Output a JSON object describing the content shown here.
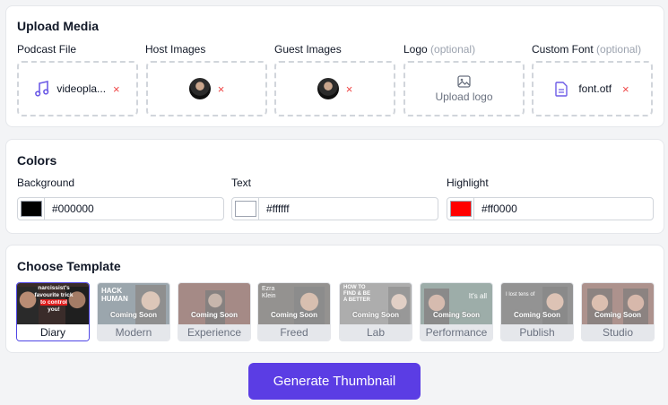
{
  "upload": {
    "title": "Upload Media",
    "podcast_label": "Podcast File",
    "podcast_file": "videopla...",
    "host_label": "Host Images",
    "guest_label": "Guest Images",
    "logo_label": "Logo",
    "logo_optional": "(optional)",
    "logo_placeholder": "Upload logo",
    "font_label": "Custom Font",
    "font_optional": "(optional)",
    "font_file": "font.otf",
    "remove_glyph": "×"
  },
  "colors": {
    "title": "Colors",
    "background": {
      "label": "Background",
      "hex": "#000000"
    },
    "text": {
      "label": "Text",
      "hex": "#ffffff"
    },
    "highlight": {
      "label": "Highlight",
      "hex": "#ff0000"
    }
  },
  "template": {
    "title": "Choose Template",
    "coming_soon": "Coming Soon",
    "selected": "Diary",
    "items": [
      {
        "name": "Diary",
        "thumb_text": [
          "narcissist's",
          "favourite trick",
          "to control",
          "you!"
        ],
        "bg": "#3a2c2a"
      },
      {
        "name": "Modern",
        "thumb_text": [
          "HACK",
          "HUMAN"
        ],
        "bg": "#4a5d6b"
      },
      {
        "name": "Experience",
        "thumb_text": [],
        "bg": "#5c2a24"
      },
      {
        "name": "Freed",
        "thumb_text": [
          "Ezra",
          "Klein"
        ],
        "bg": "#3c3a36"
      },
      {
        "name": "Lab",
        "thumb_text": [
          "HOW TO",
          "FIND & BE",
          "A BETTER"
        ],
        "bg": "#6a6a6a"
      },
      {
        "name": "Performance",
        "thumb_text": [
          "It's all"
        ],
        "bg": "#4d6b63"
      },
      {
        "name": "Publish",
        "thumb_text": [
          "I lost tens of"
        ],
        "bg": "#3b3b3b"
      },
      {
        "name": "Studio",
        "thumb_text": [],
        "bg": "#6b3a30"
      }
    ]
  },
  "actions": {
    "generate_label": "Generate Thumbnail"
  },
  "theme": {
    "accent": "#5b3de4",
    "danger": "#ef4444",
    "icon": "#6d5ce6"
  }
}
